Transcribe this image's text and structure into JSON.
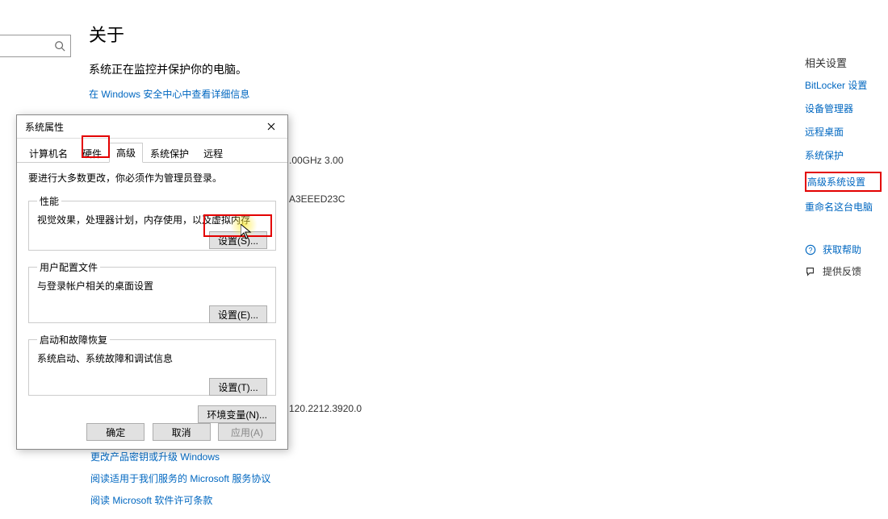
{
  "main": {
    "title": "关于",
    "subtitle": "系统正在监控并保护你的电脑。",
    "security_link": "在 Windows 安全中心中查看详细信息",
    "cpu_fragment": ".00GHz   3.00",
    "guid_fragment": "A3EEED23C",
    "ver_fragment": "120.2212.3920.0",
    "link_upgrade": "更改产品密钥或升级 Windows",
    "link_terms": "阅读适用于我们服务的 Microsoft 服务协议",
    "link_license": "阅读 Microsoft 软件许可条款"
  },
  "sidebar": {
    "header": "相关设置",
    "bitlocker": "BitLocker 设置",
    "device_mgr": "设备管理器",
    "remote_desktop": "远程桌面",
    "sys_protect": "系统保护",
    "adv_sys": "高级系统设置",
    "rename_pc": "重命名这台电脑",
    "help": "获取帮助",
    "feedback": "提供反馈"
  },
  "dialog": {
    "title": "系统属性",
    "tabs": {
      "computer_name": "计算机名",
      "hardware": "硬件",
      "advanced": "高级",
      "sys_protect": "系统保护",
      "remote": "远程"
    },
    "admin_note": "要进行大多数更改，你必须作为管理员登录。",
    "perf": {
      "legend": "性能",
      "desc": "视觉效果，处理器计划，内存使用，以及虚拟内存",
      "btn": "设置(S)..."
    },
    "profile": {
      "legend": "用户配置文件",
      "desc": "与登录帐户相关的桌面设置",
      "btn": "设置(E)..."
    },
    "startup": {
      "legend": "启动和故障恢复",
      "desc": "系统启动、系统故障和调试信息",
      "btn": "设置(T)..."
    },
    "env_btn": "环境变量(N)...",
    "ok": "确定",
    "cancel": "取消",
    "apply": "应用(A)"
  }
}
